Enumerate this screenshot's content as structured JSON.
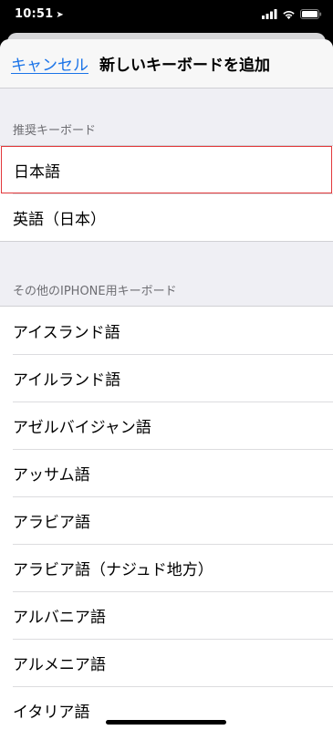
{
  "status_bar": {
    "time": "10:51",
    "location_icon": "location-arrow-icon",
    "signal_icon": "cellular-signal-icon",
    "wifi_icon": "wifi-icon",
    "battery_icon": "battery-icon"
  },
  "navbar": {
    "cancel_label": "キャンセル",
    "title": "新しいキーボードを追加"
  },
  "recommended": {
    "header": "推奨キーボード",
    "items": [
      "日本語",
      "英語（日本）"
    ]
  },
  "other": {
    "header": "その他のIPHONE用キーボード",
    "items": [
      "アイスランド語",
      "アイルランド語",
      "アゼルバイジャン語",
      "アッサム語",
      "アラビア語",
      "アラビア語（ナジュド地方）",
      "アルバニア語",
      "アルメニア語",
      "イタリア語"
    ]
  },
  "colors": {
    "accent": "#1a73e8",
    "highlight_border": "#e2383b",
    "background": "#efeff4"
  }
}
